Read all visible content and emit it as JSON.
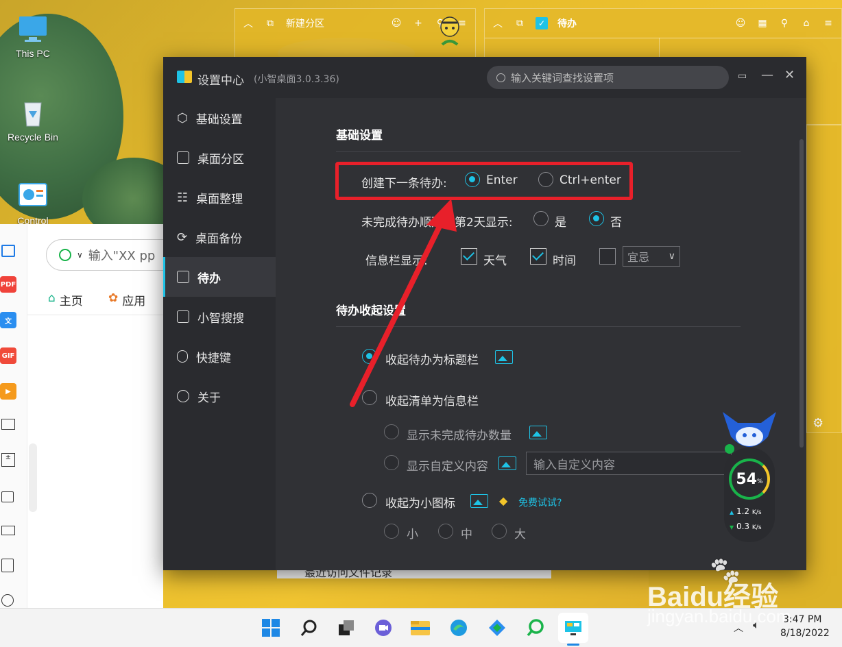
{
  "desktop": {
    "icons": [
      {
        "label": "This PC"
      },
      {
        "label": "Recycle Bin"
      },
      {
        "label": "Control"
      }
    ]
  },
  "widget_partition": {
    "title": "新建分区"
  },
  "widget_todo": {
    "title": "待办"
  },
  "left_app": {
    "search_placeholder": "输入\"XX pp",
    "tab_home": "主页",
    "tab_apps": "应用",
    "footer_text": "最近访问文件记录",
    "rail_labels": [
      "PDF",
      "文",
      "GIF"
    ]
  },
  "settings": {
    "window_title": "设置中心",
    "version": "(小智桌面3.0.3.36)",
    "search_placeholder": "输入关键词查找设置项",
    "sidebar": [
      {
        "label": "基础设置",
        "icon": "hexagon-icon"
      },
      {
        "label": "桌面分区",
        "icon": "monitor-icon"
      },
      {
        "label": "桌面整理",
        "icon": "grid-list-icon"
      },
      {
        "label": "桌面备份",
        "icon": "sync-icon"
      },
      {
        "label": "待办",
        "icon": "calendar-check-icon",
        "active": true
      },
      {
        "label": "小智搜搜",
        "icon": "window-icon"
      },
      {
        "label": "快捷键",
        "icon": "mouse-icon"
      },
      {
        "label": "关于",
        "icon": "info-icon"
      }
    ],
    "basic": {
      "title": "基础设置",
      "create_next_label": "创建下一条待办:",
      "create_opt_enter": "Enter",
      "create_opt_ctrl": "Ctrl+enter",
      "create_selected": "Enter",
      "unfinished_label": "未完成待办顺延至第2天显示:",
      "unfinished_yes": "是",
      "unfinished_no": "否",
      "unfinished_selected": "否",
      "infobar_label": "信息栏显示:",
      "weather": "天气",
      "weather_checked": true,
      "time": "时间",
      "time_checked": true,
      "almanac_checked": false,
      "almanac_select": "宜忌"
    },
    "collapse": {
      "title": "待办收起设置",
      "opt_title_bar": "收起待办为标题栏",
      "opt_info_bar": "收起清单为信息栏",
      "sub_show_count": "显示未完成待办数量",
      "sub_show_custom": "显示自定义内容",
      "custom_placeholder": "输入自定义内容",
      "opt_small_icon": "收起为小图标",
      "free_trial": "免费试试?",
      "size_small": "小",
      "size_medium": "中",
      "size_large": "大",
      "selected": "收起待办为标题栏"
    }
  },
  "monitor": {
    "percent": "54",
    "percent_unit": "%",
    "up_speed": "1.2",
    "down_speed": "0.3",
    "speed_unit": "K/s"
  },
  "taskbar": {
    "time": "3:47 PM",
    "date": "8/18/2022"
  },
  "watermark": {
    "brand": "Baidu经验",
    "url": "jingyan.baidu.com"
  },
  "colors": {
    "accent": "#1ec3e6",
    "annotation": "#e8202a",
    "window_bg": "#2f3034"
  }
}
